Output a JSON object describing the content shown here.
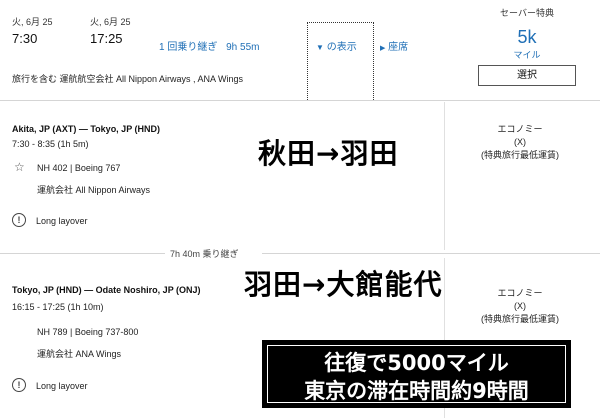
{
  "summary": {
    "depart_date": "火, 6月 25",
    "depart_time": "7:30",
    "arrive_date": "火, 6月 25",
    "arrive_time": "17:25",
    "stops": "1 回乗り継ぎ",
    "duration": "9h 55m",
    "toggle_label": "の表示",
    "seat_label": "座席",
    "operated_by": "旅行を含む 運航航空会社 All Nippon Airways , ANA Wings",
    "saver_label": "セーバー特典",
    "miles_value": "5k",
    "miles_unit": "マイル",
    "select_label": "選択"
  },
  "segments": [
    {
      "route": "Akita, JP (AXT) — Tokyo, JP (HND)",
      "times": "7:30 - 8:35 (1h 5m)",
      "flight": "NH 402 | Boeing 767",
      "carrier": "運航会社 All Nippon Airways",
      "overlay": "秋田→羽田",
      "cabin": "エコノミー",
      "fare_code": "(X)",
      "fare_desc": "(特典旅行最低運賃)",
      "layover_note": "Long layover"
    },
    {
      "route": "Tokyo, JP (HND) — Odate Noshiro, JP (ONJ)",
      "times": "16:15 - 17:25 (1h 10m)",
      "flight": "NH 789 | Boeing 737-800",
      "carrier": "運航会社 ANA Wings",
      "overlay": "羽田→大館能代",
      "cabin": "エコノミー",
      "fare_code": "(X)",
      "fare_desc": "(特典旅行最低運賃)",
      "layover_note": "Long layover"
    }
  ],
  "connection": "7h 40m 乗り継ぎ",
  "caption": {
    "line1": "往復で5000マイル",
    "line2": "東京の滞在時間約9時間"
  },
  "icons": {
    "star": "☆",
    "warn": "!",
    "caret": "▼",
    "play": "▶"
  },
  "colors": {
    "link": "#1f6fb6",
    "caption_bg": "#000000",
    "caption_text": "#ffffff"
  }
}
